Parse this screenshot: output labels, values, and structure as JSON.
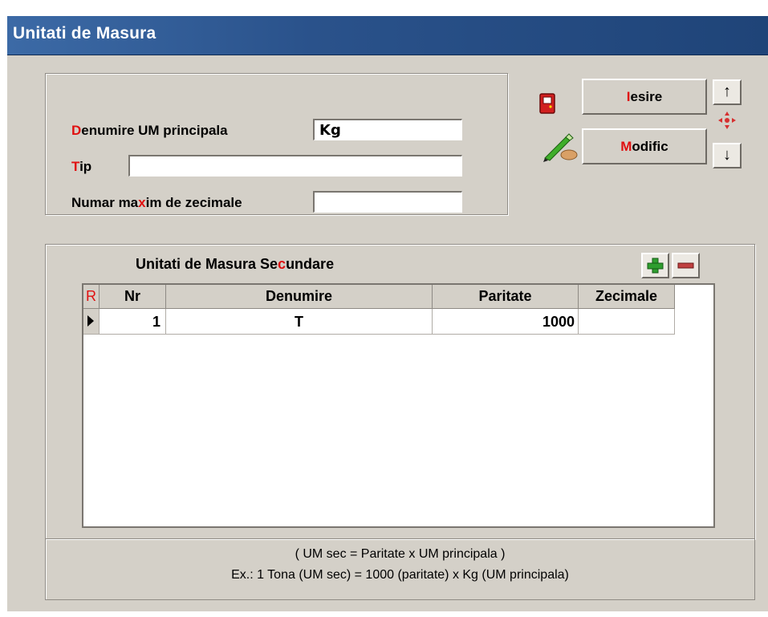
{
  "window": {
    "title": "Unitati de Masura"
  },
  "form": {
    "denumire": {
      "label_hotkey": "D",
      "label_rest": "enumire UM principala",
      "value": "Kg"
    },
    "tip": {
      "label_hotkey": "T",
      "label_rest": "ip",
      "value": ""
    },
    "zecimale": {
      "label_pre": "Numar ma",
      "label_hotkey": "x",
      "label_post": "im de zecimale",
      "value": ""
    }
  },
  "buttons": {
    "iesire": {
      "hotkey": "I",
      "rest": "esire"
    },
    "modific": {
      "hotkey": "M",
      "rest": "odific"
    },
    "nav_up": "↑",
    "nav_down": "↓"
  },
  "icons": [
    "exit-door-icon",
    "edit-pen-icon",
    "center-crosshair-icon",
    "plus-icon",
    "minus-icon",
    "row-pointer-icon"
  ],
  "grid": {
    "title_pre": "Unitati de Masura Se",
    "title_hotkey": "c",
    "title_post": "undare",
    "indicator_header": "R",
    "columns": [
      "Nr",
      "Denumire",
      "Paritate",
      "Zecimale"
    ],
    "rows": [
      {
        "nr": "1",
        "denumire": "T",
        "paritate": "1000",
        "zecimale": ""
      }
    ]
  },
  "footer": {
    "line1": "( UM sec = Paritate x UM principala )",
    "line2": "Ex.: 1 Tona (UM sec) = 1000 (paritate) x Kg (UM principala)"
  },
  "colors": {
    "titlebar": "#2a528b",
    "background": "#d4d0c8",
    "hotkey": "#e01010"
  }
}
